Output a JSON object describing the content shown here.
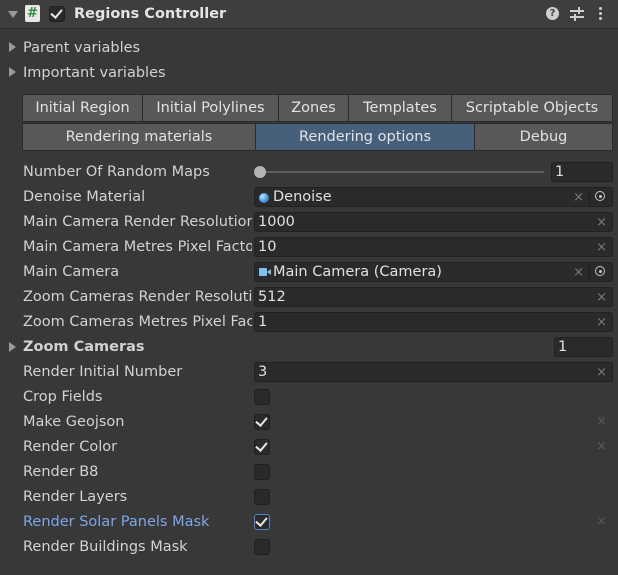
{
  "header": {
    "title": "Regions Controller",
    "enabled": true,
    "icons": [
      "expand-triangle-icon",
      "script-icon",
      "help-icon",
      "presets-icon",
      "kebab-menu-icon"
    ]
  },
  "foldouts": {
    "parent_variables": "Parent variables",
    "important_variables": "Important variables"
  },
  "tabs_row1": [
    {
      "label": "Initial Region",
      "active": false
    },
    {
      "label": "Initial Polylines",
      "active": false
    },
    {
      "label": "Zones",
      "active": false
    },
    {
      "label": "Templates",
      "active": false
    },
    {
      "label": "Scriptable Objects",
      "active": false
    }
  ],
  "tabs_row2": [
    {
      "label": "Rendering materials",
      "active": false
    },
    {
      "label": "Rendering options",
      "active": true
    },
    {
      "label": "Debug",
      "active": false
    }
  ],
  "fields": {
    "random_maps": {
      "label": "Number Of Random Maps",
      "value": "1",
      "slider_fraction": 0
    },
    "denoise_material": {
      "label": "Denoise Material",
      "value": "Denoise"
    },
    "main_cam_res": {
      "label": "Main Camera Render Resolution",
      "value": "1000"
    },
    "main_cam_mpp": {
      "label": "Main Camera Metres Pixel Factor",
      "value": "10"
    },
    "main_camera": {
      "label": "Main Camera",
      "value": "Main Camera (Camera)"
    },
    "zoom_cam_res": {
      "label": "Zoom Cameras Render Resolution",
      "value": "512"
    },
    "zoom_cam_mpp": {
      "label": "Zoom Cameras Metres Pixel Factor",
      "value": "1"
    },
    "zoom_cameras": {
      "label": "Zoom Cameras",
      "value": "1"
    },
    "render_initial_number": {
      "label": "Render Initial Number",
      "value": "3"
    }
  },
  "toggles": [
    {
      "label": "Crop Fields",
      "checked": false,
      "highlighted": false
    },
    {
      "label": "Make Geojson",
      "checked": true,
      "highlighted": false
    },
    {
      "label": "Render Color",
      "checked": true,
      "highlighted": false
    },
    {
      "label": "Render B8",
      "checked": false,
      "highlighted": false
    },
    {
      "label": "Render Layers",
      "checked": false,
      "highlighted": false
    },
    {
      "label": "Render Solar Panels Mask",
      "checked": true,
      "highlighted": true
    },
    {
      "label": "Render Buildings Mask",
      "checked": false,
      "highlighted": false
    }
  ],
  "clear_glyph": "×",
  "colors": {
    "background": "#383838",
    "active_tab": "#46607c",
    "highlight_label": "#7ea6e8"
  }
}
